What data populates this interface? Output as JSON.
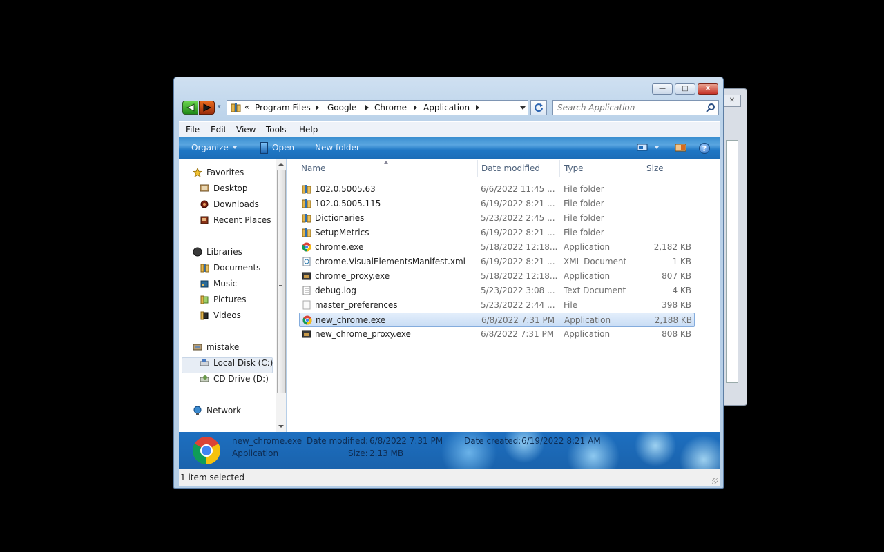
{
  "window": {
    "min_label": "—",
    "max_label": "□",
    "close_label": "X"
  },
  "address": {
    "chevrons": "«",
    "crumbs": [
      "Program Files",
      "Google",
      "Chrome",
      "Application"
    ]
  },
  "search": {
    "placeholder": "Search Application"
  },
  "menu": {
    "items": [
      "File",
      "Edit",
      "View",
      "Tools",
      "Help"
    ]
  },
  "commands": {
    "organize": "Organize",
    "open": "Open",
    "new_folder": "New folder",
    "help": "?"
  },
  "nav": {
    "favorites": "Favorites",
    "desktop": "Desktop",
    "downloads": "Downloads",
    "recent": "Recent Places",
    "libraries": "Libraries",
    "documents": "Documents",
    "music": "Music",
    "pictures": "Pictures",
    "videos": "Videos",
    "computer": "mistake",
    "local_disk": "Local Disk (C:)",
    "cd_drive": "CD Drive (D:)",
    "network": "Network"
  },
  "columns": {
    "name": "Name",
    "date": "Date modified",
    "type": "Type",
    "size": "Size"
  },
  "files": [
    {
      "name": "102.0.5005.63",
      "date": "6/6/2022 11:45 ...",
      "type": "File folder",
      "size": "",
      "icon": "folder-icon"
    },
    {
      "name": "102.0.5005.115",
      "date": "6/19/2022 8:21 ...",
      "type": "File folder",
      "size": "",
      "icon": "folder-icon"
    },
    {
      "name": "Dictionaries",
      "date": "5/23/2022 2:45 ...",
      "type": "File folder",
      "size": "",
      "icon": "folder-icon"
    },
    {
      "name": "SetupMetrics",
      "date": "6/19/2022 8:21 ...",
      "type": "File folder",
      "size": "",
      "icon": "folder-icon"
    },
    {
      "name": "chrome.exe",
      "date": "5/18/2022 12:18...",
      "type": "Application",
      "size": "2,182 KB",
      "icon": "chrome-icon"
    },
    {
      "name": "chrome.VisualElementsManifest.xml",
      "date": "6/19/2022 8:21 ...",
      "type": "XML Document",
      "size": "1 KB",
      "icon": "xml-file-icon"
    },
    {
      "name": "chrome_proxy.exe",
      "date": "5/18/2022 12:18...",
      "type": "Application",
      "size": "807 KB",
      "icon": "app-icon"
    },
    {
      "name": "debug.log",
      "date": "5/23/2022 3:08 ...",
      "type": "Text Document",
      "size": "4 KB",
      "icon": "text-file-icon"
    },
    {
      "name": "master_preferences",
      "date": "5/23/2022 2:44 ...",
      "type": "File",
      "size": "398 KB",
      "icon": "file-icon"
    },
    {
      "name": "new_chrome.exe",
      "date": "6/8/2022 7:31 PM",
      "type": "Application",
      "size": "2,188 KB",
      "icon": "chrome-icon",
      "selected": true
    },
    {
      "name": "new_chrome_proxy.exe",
      "date": "6/8/2022 7:31 PM",
      "type": "Application",
      "size": "808 KB",
      "icon": "app-icon"
    }
  ],
  "details": {
    "name": "new_chrome.exe",
    "kind": "Application",
    "modified_label": "Date modified:",
    "modified_value": "6/8/2022 7:31 PM",
    "created_label": "Date created:",
    "created_value": "6/19/2022 8:21 AM",
    "size_label": "Size:",
    "size_value": "2.13 MB"
  },
  "status": {
    "text": "1 item selected"
  }
}
